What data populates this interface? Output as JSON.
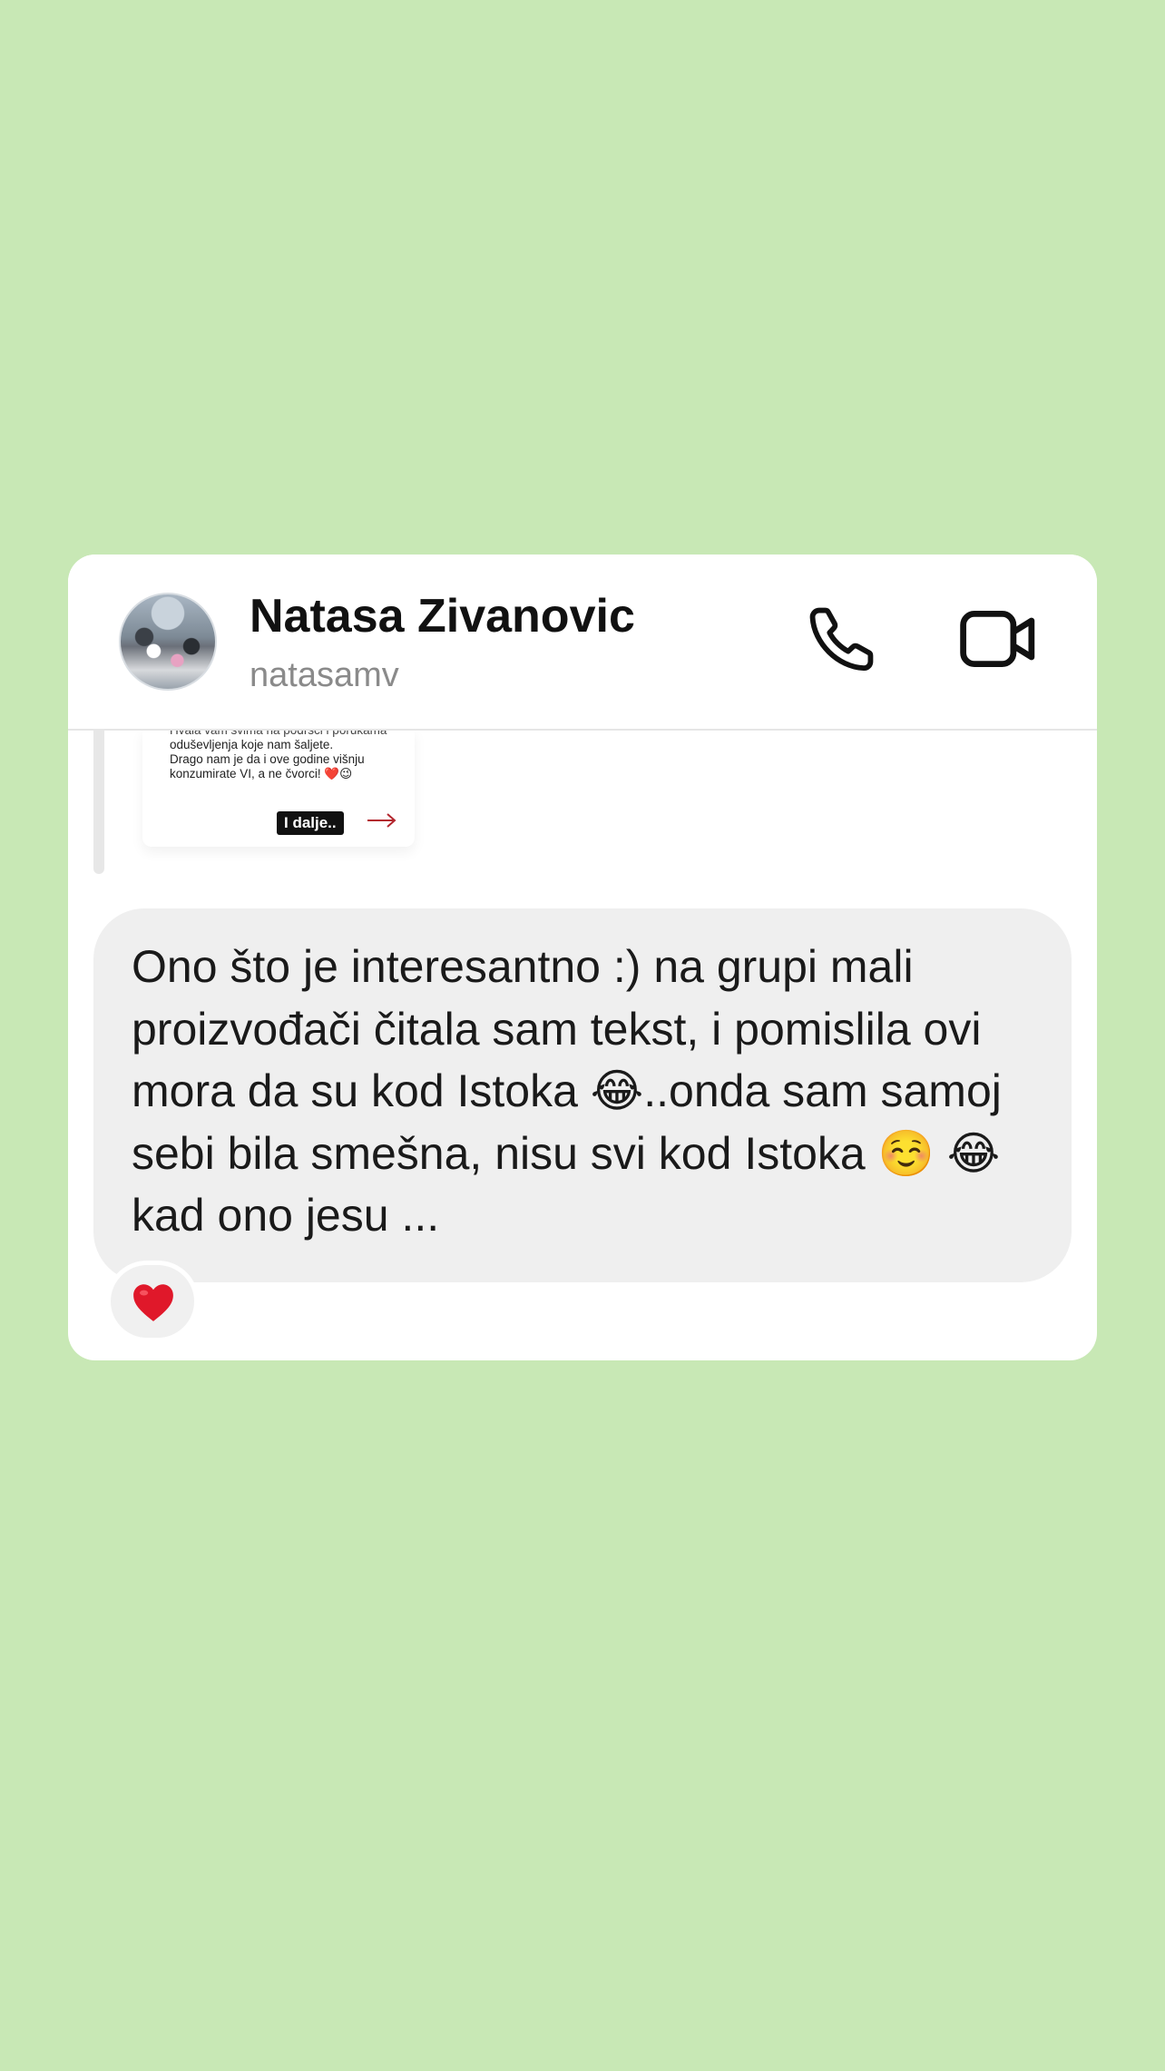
{
  "header": {
    "name": "Natasa Zivanovic",
    "username": "natasamv",
    "avatar_icon": "profile-photo",
    "call_icon": "phone-icon",
    "video_icon": "video-camera-icon"
  },
  "shared_post": {
    "lines": [
      "Hvala vam svima na podršci i porukama",
      "oduševljenja koje nam šaljete.",
      "Drago nam je da i ove godine višnju",
      "konzumirate VI, a ne čvorci! ❤️😉"
    ],
    "more_label": "I dalje.."
  },
  "message": {
    "text": "Ono što je interesantno :) na grupi mali proizvođači  čitala sam tekst, i pomislila ovi mora da su kod Istoka 😂..onda sam samoj sebi bila smešna, nisu svi kod Istoka ☺️ 😂  kad ono jesu ...",
    "reaction": "❤️"
  },
  "colors": {
    "background": "#c8e8b5",
    "card": "#ffffff",
    "bubble": "#efefef",
    "heart": "#e0182a"
  }
}
